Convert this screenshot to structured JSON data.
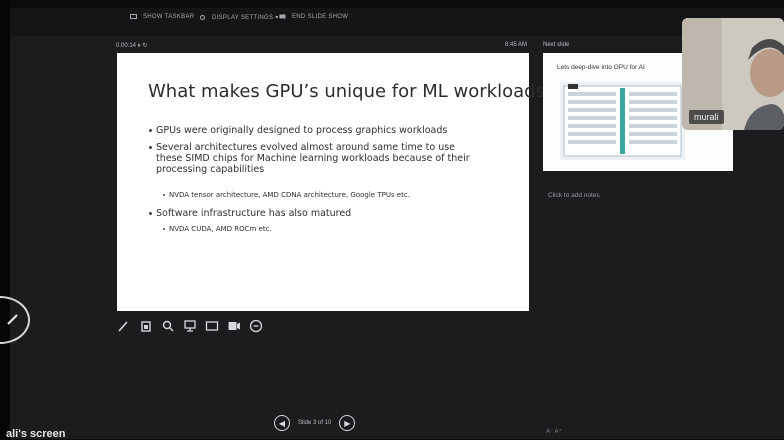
{
  "window": {
    "background": "#1c1c1f",
    "accent": "#ffffff"
  },
  "topbar": {
    "items": [
      {
        "icon": "display-icon",
        "label": "SHOW TASKBAR"
      },
      {
        "icon": "settings-icon",
        "label": "DISPLAY SETTINGS ▾"
      },
      {
        "icon": "end-show-icon",
        "label": "END SLIDE SHOW"
      }
    ]
  },
  "presenter": {
    "timer": "0:00:14 ⏸ ↻",
    "clock": "8:45 AM"
  },
  "slide": {
    "title": "What makes GPU’s unique for ML workloads",
    "bullets": [
      {
        "level": 1,
        "lines": [
          "GPUs were originally designed to process graphics workloads"
        ]
      },
      {
        "level": 1,
        "lines": [
          "Several architectures evolved almost around same time to use",
          "these SIMD chips for Machine learning workloads because of their",
          "processing capabilities"
        ]
      },
      {
        "level": 2,
        "lines": [
          "NVDA tensor architecture, AMD CDNA architecture, Google TPUs etc."
        ]
      },
      {
        "level": 1,
        "lines": [
          "Software infrastructure has also matured"
        ]
      },
      {
        "level": 2,
        "lines": [
          "NVDA CUDA, AMD ROCm etc."
        ]
      }
    ]
  },
  "tools": [
    "pen-icon",
    "laser-pointer-icon",
    "zoom-icon",
    "see-all-slides-icon",
    "subtitles-icon",
    "camera-icon",
    "more-options-icon"
  ],
  "next_slide": {
    "label": "Next slide",
    "title": "Lets deep-dive into GPU for AI"
  },
  "notes": {
    "placeholder": "Click to add notes"
  },
  "navigation": {
    "slide_count": "Slide 3 of 10"
  },
  "share": {
    "screen_label": "ali's screen"
  },
  "participant": {
    "name": "murali"
  },
  "bottom_marks": "A⁻ A⁺"
}
